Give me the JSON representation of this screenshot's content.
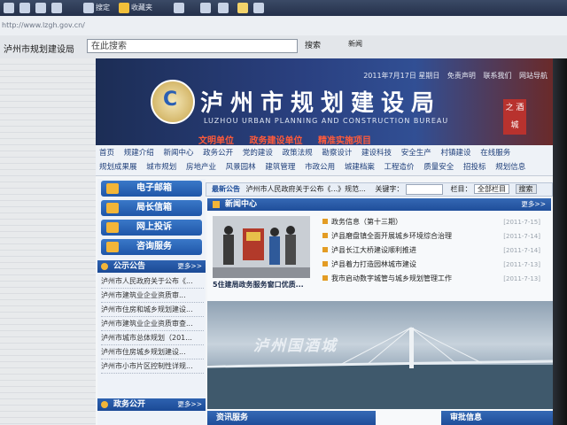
{
  "browser": {
    "toolbar": {
      "items": [
        "搜定",
        "收藏夹"
      ]
    },
    "url": "http://www.lzgh.gov.cn/",
    "tab_title": "泸州市规划建设局",
    "search": {
      "value": "在此搜索",
      "button": "搜索"
    },
    "news_button": "新闻"
  },
  "site": {
    "top_links": [
      "2011年7月17日 星期日",
      "免责声明",
      "联系我们",
      "网站导航"
    ],
    "title": "泸州市规划建设局",
    "title_en": "LUZHOU URBAN PLANNING AND CONSTRUCTION BUREAU",
    "slogans": [
      "文明单位",
      "政务建设单位",
      "精准实施项目"
    ],
    "badge": "之 酒 城",
    "nav_row1": [
      "首页",
      "规建介绍",
      "新闻中心",
      "政务公开",
      "党的建设",
      "政策法规",
      "勘察设计",
      "建设科技",
      "安全生产",
      "村镇建设",
      "在线服务"
    ],
    "nav_row2": [
      "规划成果展",
      "城市规划",
      "房地产业",
      "风景园林",
      "建筑管理",
      "市政公用",
      "城建档案",
      "工程造价",
      "质量安全",
      "招投标",
      "规划信息"
    ],
    "services": [
      "电子邮箱",
      "局长信箱",
      "网上投诉",
      "咨询服务"
    ],
    "notices_head": {
      "title": "公示公告",
      "more": "更多>>"
    },
    "notices": [
      "泸州市人民政府关于公布《...",
      "泸州市建筑业企业资质审...",
      "泸州市住房和城乡规划建设...",
      "泸州市建筑业企业资质审查...",
      "泸州市城市总体规划（201...",
      "泸州市住房城乡规划建设...",
      "泸州市小市片区控制性详规..."
    ],
    "gov_head": {
      "title": "政务公开",
      "more": "更多>>"
    },
    "strip": {
      "label": "最新公告",
      "text": "泸州市人民政府关于公布《...》规范...",
      "keyword_label": "关键字：",
      "column_label": "栏目：",
      "column_value": "全部栏目",
      "search_button": "搜索"
    },
    "news": {
      "title": "新闻中心",
      "more": "更多>>",
      "photo_caption": "5住建局政务服务窗口优质...",
      "items": [
        {
          "text": "政务信息（第十三期）",
          "date": "[2011-7-15]"
        },
        {
          "text": "泸县磨盘镇全面开展城乡环境综合治理",
          "date": "[2011-7-14]"
        },
        {
          "text": "泸县长江大桥建设顺利推进",
          "date": "[2011-7-14]"
        },
        {
          "text": "泸县着力打造园林城市建设",
          "date": "[2011-7-13]"
        },
        {
          "text": "我市启动数字城管与城乡规划管理工作",
          "date": "[2011-7-13]"
        }
      ]
    },
    "banner_text": "泸州国酒城",
    "bottom_heads": [
      "资讯服务",
      "审批信息"
    ]
  }
}
